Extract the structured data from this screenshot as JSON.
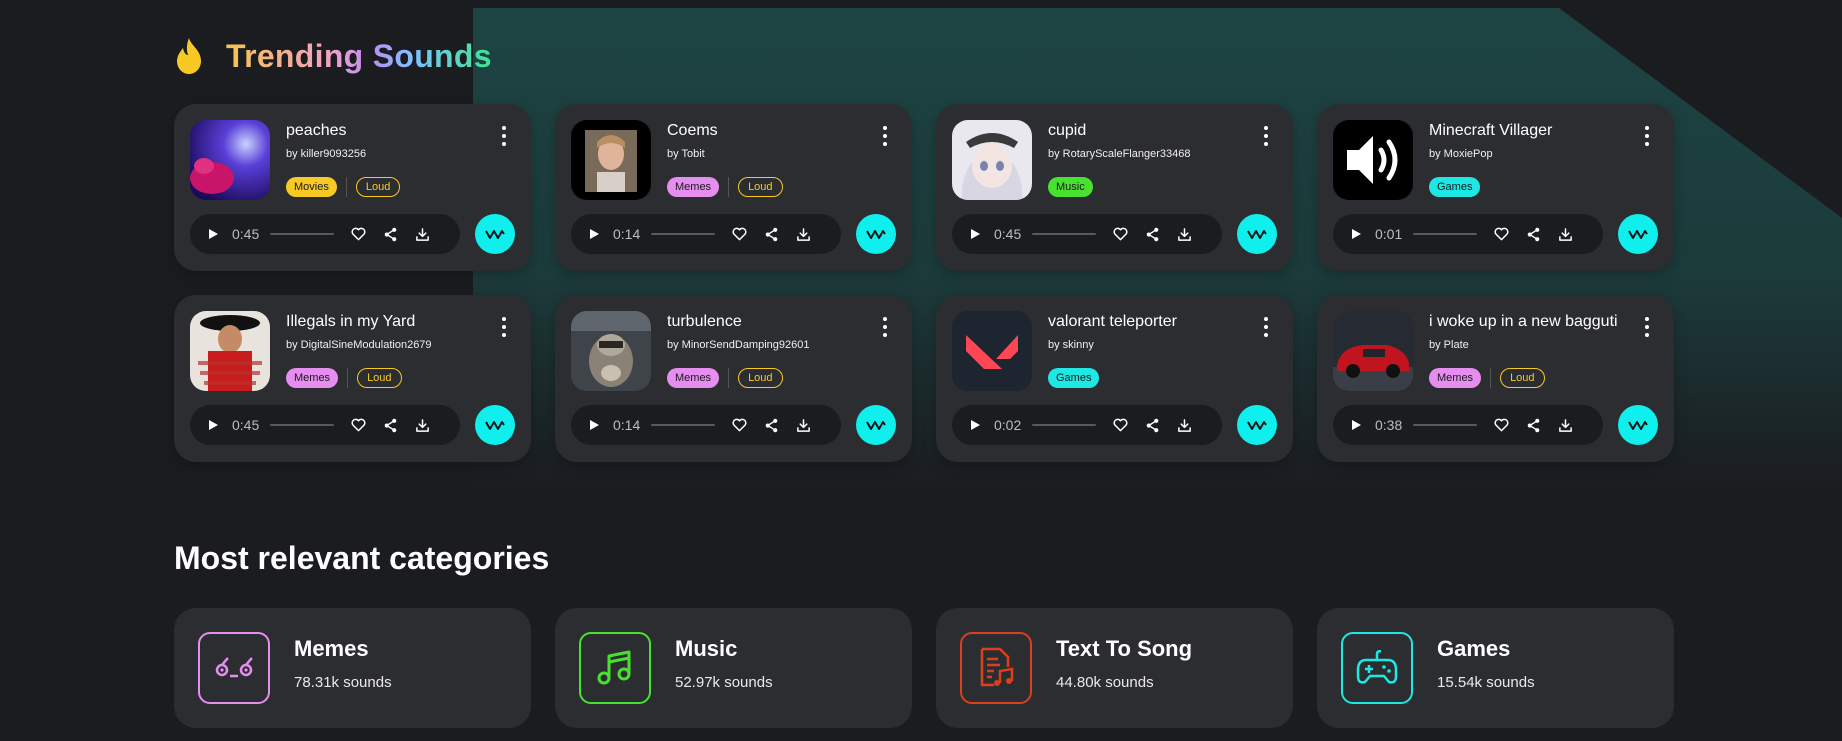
{
  "trending": {
    "title": "Trending Sounds",
    "sounds": [
      {
        "title": "peaches",
        "author": "by killer9093256",
        "time": "0:45",
        "tags": [
          {
            "label": "Movies",
            "style": "filled",
            "color": "#f7c925"
          },
          {
            "label": "Loud",
            "style": "outline",
            "color": "#f7c925"
          }
        ],
        "thumb": "peaches"
      },
      {
        "title": "Coems",
        "author": "by Tobit",
        "time": "0:14",
        "tags": [
          {
            "label": "Memes",
            "style": "filled",
            "color": "#e58ef0"
          },
          {
            "label": "Loud",
            "style": "outline",
            "color": "#f7c925"
          }
        ],
        "thumb": "coems"
      },
      {
        "title": "cupid",
        "author": "by RotaryScaleFlanger33468",
        "time": "0:45",
        "tags": [
          {
            "label": "Music",
            "style": "filled",
            "color": "#49e12f"
          }
        ],
        "thumb": "cupid"
      },
      {
        "title": "Minecraft Villager",
        "author": "by MoxiePop",
        "time": "0:01",
        "tags": [
          {
            "label": "Games",
            "style": "filled",
            "color": "#1de8e4"
          }
        ],
        "thumb": "speaker"
      },
      {
        "title": "Illegals in my Yard",
        "author": "by DigitalSineModulation2679",
        "time": "0:45",
        "tags": [
          {
            "label": "Memes",
            "style": "filled",
            "color": "#e58ef0"
          },
          {
            "label": "Loud",
            "style": "outline",
            "color": "#f7c925"
          }
        ],
        "thumb": "illegals"
      },
      {
        "title": "turbulence",
        "author": "by MinorSendDamping92601",
        "time": "0:14",
        "tags": [
          {
            "label": "Memes",
            "style": "filled",
            "color": "#e58ef0"
          },
          {
            "label": "Loud",
            "style": "outline",
            "color": "#f7c925"
          }
        ],
        "thumb": "raccoon"
      },
      {
        "title": "valorant teleporter",
        "author": "by skinny",
        "time": "0:02",
        "tags": [
          {
            "label": "Games",
            "style": "filled",
            "color": "#1de8e4"
          }
        ],
        "thumb": "valorant"
      },
      {
        "title": "i woke up in a new bagguti",
        "author": "by Plate",
        "time": "0:38",
        "tags": [
          {
            "label": "Memes",
            "style": "filled",
            "color": "#e58ef0"
          },
          {
            "label": "Loud",
            "style": "outline",
            "color": "#f7c925"
          }
        ],
        "thumb": "car"
      }
    ]
  },
  "categories": {
    "title": "Most relevant categories",
    "items": [
      {
        "name": "Memes",
        "count": "78.31k sounds",
        "icon": "meme-face-icon",
        "color": "#e58ef0"
      },
      {
        "name": "Music",
        "count": "52.97k sounds",
        "icon": "music-note-icon",
        "color": "#49e12f"
      },
      {
        "name": "Text To Song",
        "count": "44.80k sounds",
        "icon": "text-to-song-icon",
        "color": "#d9411e"
      },
      {
        "name": "Games",
        "count": "15.54k sounds",
        "icon": "gamepad-icon",
        "color": "#1de8e4"
      }
    ]
  },
  "colors": {
    "accent": "#0ff0ee",
    "card_bg": "#2c2d31",
    "page_bg": "#1b1c20"
  }
}
